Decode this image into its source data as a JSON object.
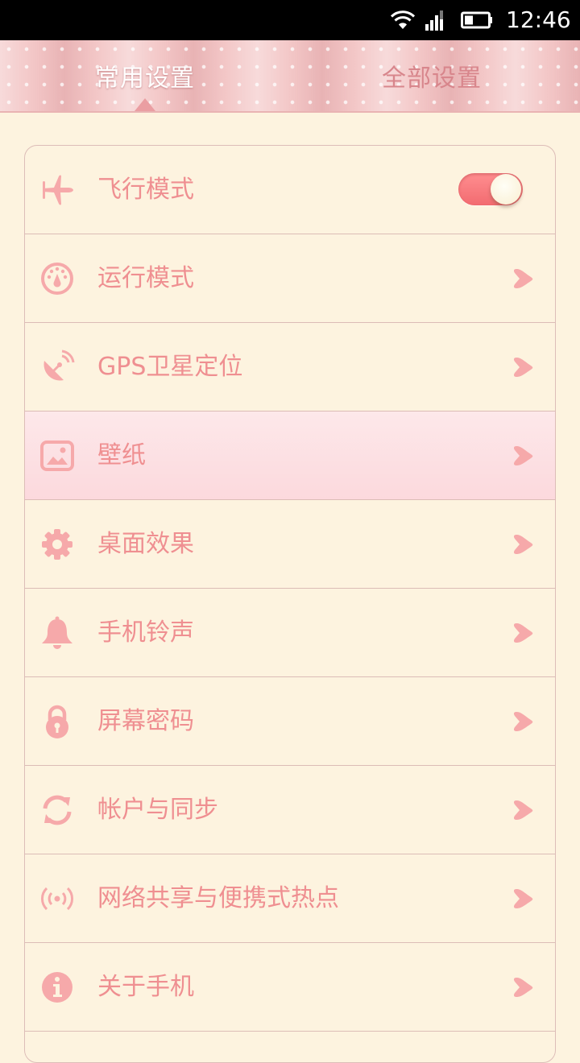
{
  "status_bar": {
    "time": "12:46",
    "icons": [
      "wifi-icon",
      "signal-icon",
      "battery-icon"
    ]
  },
  "tabs": {
    "common": "常用设置",
    "all": "全部设置",
    "active": "common"
  },
  "colors": {
    "accent": "#ef8f91",
    "background": "#fdf3df",
    "selected_row": "#fcdde0"
  },
  "settings": [
    {
      "label": "飞行模式",
      "icon": "airplane-icon",
      "control": "toggle",
      "toggle_on": true
    },
    {
      "label": "运行模式",
      "icon": "speedometer-icon",
      "control": "arrow"
    },
    {
      "label": "GPS卫星定位",
      "icon": "satellite-icon",
      "control": "arrow"
    },
    {
      "label": "壁纸",
      "icon": "wallpaper-icon",
      "control": "arrow",
      "selected": true
    },
    {
      "label": "桌面效果",
      "icon": "gear-icon",
      "control": "arrow"
    },
    {
      "label": "手机铃声",
      "icon": "bell-icon",
      "control": "arrow"
    },
    {
      "label": "屏幕密码",
      "icon": "lock-icon",
      "control": "arrow"
    },
    {
      "label": "帐户与同步",
      "icon": "sync-icon",
      "control": "arrow"
    },
    {
      "label": "网络共享与便携式热点",
      "icon": "hotspot-icon",
      "control": "arrow"
    },
    {
      "label": "关于手机",
      "icon": "info-icon",
      "control": "arrow"
    }
  ]
}
